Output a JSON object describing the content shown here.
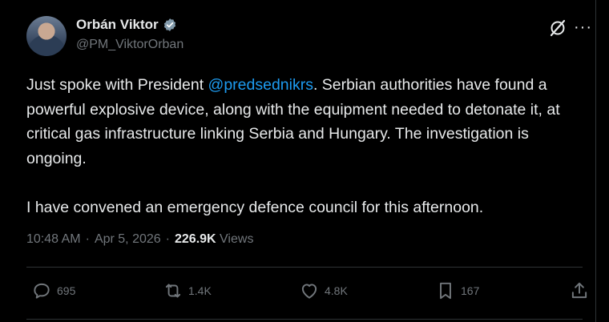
{
  "author": {
    "name": "Orbán Viktor",
    "handle": "@PM_ViktorOrban"
  },
  "tweet": {
    "text_before_mention": "Just spoke with President ",
    "mention": "@predsednikrs",
    "text_after_mention": ". Serbian authorities have found a powerful explosive device, along with the equipment needed to detonate it, at critical gas infrastructure linking Serbia and Hungary. The investigation is ongoing.",
    "paragraph2": "I have convened an emergency defence council for this afternoon."
  },
  "meta": {
    "time": "10:48 AM",
    "sep1": "·",
    "date": "Apr 5, 2026",
    "sep2": "·",
    "views_count": "226.9K",
    "views_label": "Views"
  },
  "actions": {
    "replies": "695",
    "reposts": "1.4K",
    "likes": "4.8K",
    "bookmarks": "167"
  },
  "colors": {
    "background": "#000000",
    "text": "#e7e9ea",
    "muted": "#71767b",
    "accent": "#1d9bf0",
    "divider": "#2f3336"
  },
  "icons": [
    "verified-badge-icon",
    "grok-icon",
    "more-icon",
    "reply-icon",
    "repost-icon",
    "like-icon",
    "bookmark-icon",
    "share-icon"
  ]
}
